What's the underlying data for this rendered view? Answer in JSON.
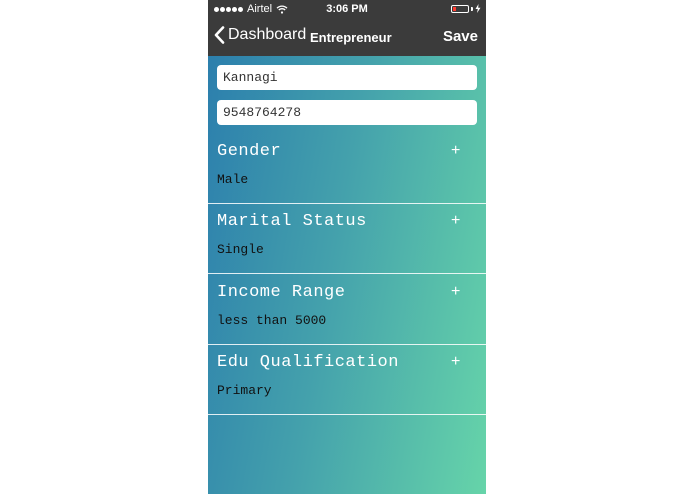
{
  "status_bar": {
    "carrier": "Airtel",
    "time": "3:06 PM",
    "battery_color": "#ff3b30"
  },
  "nav": {
    "back_label": "Dashboard",
    "title": "Entrepreneur",
    "save_label": "Save"
  },
  "form": {
    "name_value": "Kannagi",
    "phone_value": "9548764278"
  },
  "sections": [
    {
      "title": "Gender",
      "value": "Male"
    },
    {
      "title": "Marital Status",
      "value": "Single"
    },
    {
      "title": "Income Range",
      "value": "less than 5000"
    },
    {
      "title": "Edu Qualification",
      "value": "Primary"
    }
  ],
  "icons": {
    "expand": "+"
  }
}
